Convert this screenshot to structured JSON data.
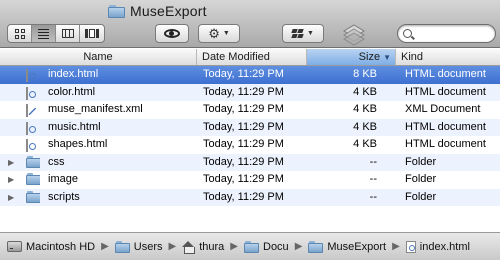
{
  "window": {
    "title": "MuseExport",
    "icon": "folder-icon"
  },
  "toolbar": {
    "view_modes": [
      {
        "name": "icon-view",
        "icon": "icon-view-icon",
        "active": false
      },
      {
        "name": "list-view",
        "icon": "list-view-icon",
        "active": true
      },
      {
        "name": "column-view",
        "icon": "column-view-icon",
        "active": false
      },
      {
        "name": "cover-flow",
        "icon": "cover-flow-icon",
        "active": false
      }
    ],
    "quick_look_icon": "eye-icon",
    "action_icon": "gear-icon",
    "dropbox_icon": "dropbox-icon",
    "stack_icon": "stack-icon",
    "search": {
      "value": "",
      "placeholder": ""
    }
  },
  "columns": {
    "name": "Name",
    "date": "Date Modified",
    "size": "Size",
    "kind": "Kind",
    "sorted_by": "size",
    "sort_direction": "descending"
  },
  "files": [
    {
      "name": "index.html",
      "date": "Today, 11:29 PM",
      "size": "8 KB",
      "kind": "HTML document",
      "type": "html",
      "expandable": false,
      "selected": true
    },
    {
      "name": "color.html",
      "date": "Today, 11:29 PM",
      "size": "4 KB",
      "kind": "HTML document",
      "type": "html",
      "expandable": false,
      "selected": false
    },
    {
      "name": "muse_manifest.xml",
      "date": "Today, 11:29 PM",
      "size": "4 KB",
      "kind": "XML Document",
      "type": "xml",
      "expandable": false,
      "selected": false
    },
    {
      "name": "music.html",
      "date": "Today, 11:29 PM",
      "size": "4 KB",
      "kind": "HTML document",
      "type": "html",
      "expandable": false,
      "selected": false
    },
    {
      "name": "shapes.html",
      "date": "Today, 11:29 PM",
      "size": "4 KB",
      "kind": "HTML document",
      "type": "html",
      "expandable": false,
      "selected": false
    },
    {
      "name": "css",
      "date": "Today, 11:29 PM",
      "size": "--",
      "kind": "Folder",
      "type": "folder",
      "expandable": true,
      "selected": false
    },
    {
      "name": "image",
      "date": "Today, 11:29 PM",
      "size": "--",
      "kind": "Folder",
      "type": "folder",
      "expandable": true,
      "selected": false
    },
    {
      "name": "scripts",
      "date": "Today, 11:29 PM",
      "size": "--",
      "kind": "Folder",
      "type": "folder",
      "expandable": true,
      "selected": false
    }
  ],
  "path": [
    {
      "label": "Macintosh HD",
      "icon": "hard-drive-icon"
    },
    {
      "label": "Users",
      "icon": "folder-icon"
    },
    {
      "label": "thura",
      "icon": "home-icon"
    },
    {
      "label": "Docu",
      "icon": "folder-icon"
    },
    {
      "label": "MuseExport",
      "icon": "folder-icon"
    },
    {
      "label": "index.html",
      "icon": "html-document-icon"
    }
  ],
  "colors": {
    "selection": "#3d6fd1",
    "alternate_row": "#edf3fe",
    "sorted_header": "#7eaee6"
  }
}
